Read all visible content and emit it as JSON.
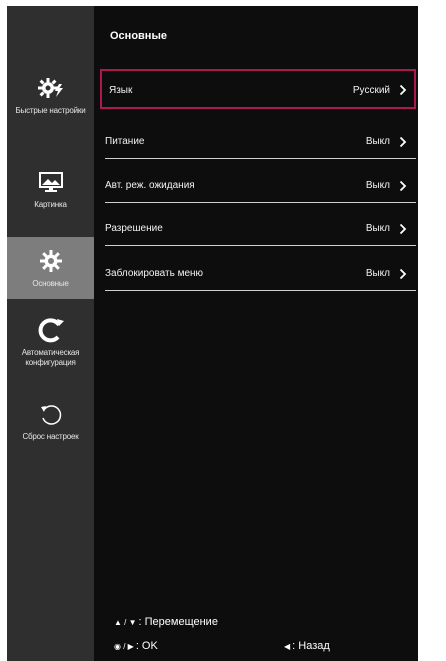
{
  "sidebar": {
    "items": [
      {
        "label": "Быстрые настройки",
        "icon": "gear-bolt-icon"
      },
      {
        "label": "Картинка",
        "icon": "monitor-picture-icon"
      },
      {
        "label": "Основные",
        "icon": "gear-icon",
        "active": true
      },
      {
        "label": "Автоматическая конфигурация",
        "icon": "auto-config-icon"
      },
      {
        "label": "Сброс настроек",
        "icon": "reset-icon"
      }
    ]
  },
  "main": {
    "title": "Основные",
    "rows": [
      {
        "label": "Язык",
        "value": "Русский",
        "focused": true
      },
      {
        "label": "Питание",
        "value": "Выкл"
      },
      {
        "label": "Авт. реж. ожидания",
        "value": "Выкл"
      },
      {
        "label": "Разрешение",
        "value": "Выкл"
      },
      {
        "label": "Заблокировать меню",
        "value": "Выкл"
      }
    ]
  },
  "footer": {
    "move_symbol": "▲ / ▼",
    "move_label": ": Перемещение",
    "ok_symbol": "◉ / ▶",
    "ok_label": ": OK",
    "back_symbol": "◀",
    "back_label": ": Назад"
  },
  "colors": {
    "focus_border": "#b0164f",
    "sidebar_bg": "#2f2f2f",
    "sidebar_active_bg": "#7d7d7d",
    "main_bg": "#0d0d0d"
  }
}
